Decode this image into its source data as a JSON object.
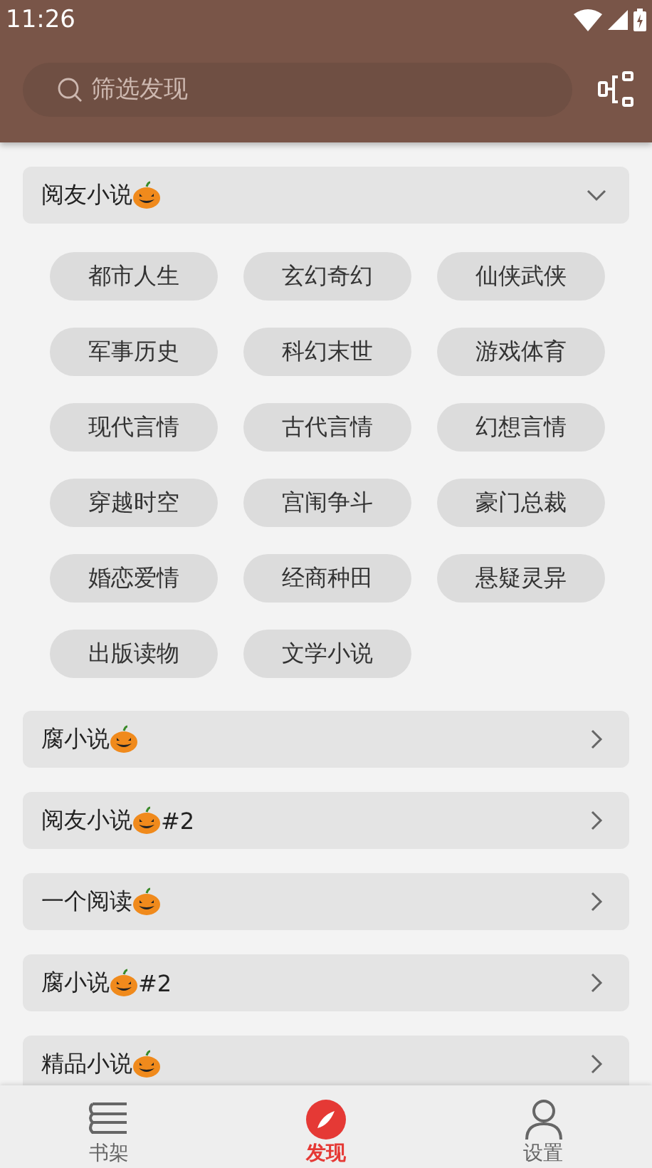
{
  "status_bar": {
    "time": "11:26"
  },
  "search": {
    "placeholder": "筛选发现"
  },
  "groups": [
    {
      "name": "阅友小说",
      "expanded": true,
      "tags": [
        "都市人生",
        "玄幻奇幻",
        "仙侠武侠",
        "军事历史",
        "科幻末世",
        "游戏体育",
        "现代言情",
        "古代言情",
        "幻想言情",
        "穿越时空",
        "宫闱争斗",
        "豪门总裁",
        "婚恋爱情",
        "经商种田",
        "悬疑灵异",
        "出版读物",
        "文学小说"
      ]
    },
    {
      "name": "腐小说",
      "expanded": false
    },
    {
      "name": "阅友小说",
      "suffix": "#2",
      "expanded": false
    },
    {
      "name": "一个阅读",
      "expanded": false
    },
    {
      "name": "腐小说",
      "suffix": "#2",
      "expanded": false
    },
    {
      "name": "精品小说",
      "expanded": false
    }
  ],
  "nav": [
    {
      "label": "书架",
      "selected": false
    },
    {
      "label": "发现",
      "selected": true
    },
    {
      "label": "设置",
      "selected": false
    }
  ]
}
